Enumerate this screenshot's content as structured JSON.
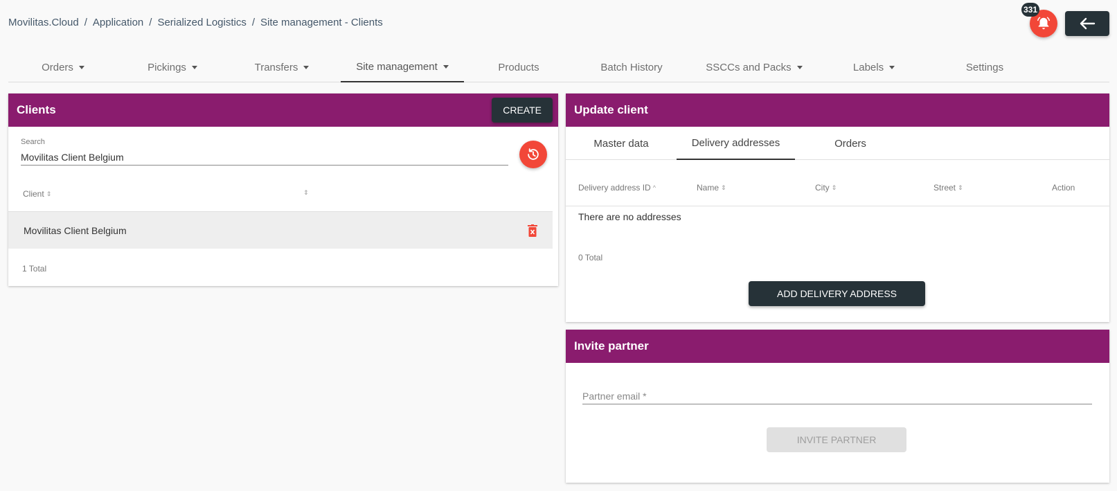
{
  "breadcrumb": {
    "items": [
      "Movilitas.Cloud",
      "Application",
      "Serialized Logistics",
      "Site management - Clients"
    ],
    "separator": "/"
  },
  "header": {
    "notification_count": "331",
    "notification_icon": "alarm-bell-icon",
    "back_icon": "arrow-left-icon"
  },
  "nav": {
    "tabs": [
      {
        "label": "Orders",
        "dropdown": true
      },
      {
        "label": "Pickings",
        "dropdown": true
      },
      {
        "label": "Transfers",
        "dropdown": true
      },
      {
        "label": "Site management",
        "dropdown": true,
        "active": true
      },
      {
        "label": "Products",
        "dropdown": false
      },
      {
        "label": "Batch History",
        "dropdown": false
      },
      {
        "label": "SSCCs and Packs",
        "dropdown": true
      },
      {
        "label": "Labels",
        "dropdown": true
      },
      {
        "label": "Settings",
        "dropdown": false
      }
    ]
  },
  "clients": {
    "title": "Clients",
    "create_label": "CREATE",
    "search_label": "Search",
    "search_value": "Movilitas Client Belgium",
    "columns": [
      "Client",
      ""
    ],
    "rows": [
      {
        "name": "Movilitas Client Belgium"
      }
    ],
    "total": "1 Total"
  },
  "update_client": {
    "title": "Update client",
    "tabs": [
      "Master data",
      "Delivery addresses",
      "Orders"
    ],
    "active_tab": "Delivery addresses",
    "columns": [
      "Delivery address ID",
      "Name",
      "City",
      "Street",
      "Action"
    ],
    "empty_message": "There are no addresses",
    "total": "0 Total",
    "add_label": "ADD DELIVERY ADDRESS"
  },
  "invite_partner": {
    "title": "Invite partner",
    "email_placeholder": "Partner email *",
    "invite_label": "INVITE PARTNER"
  },
  "colors": {
    "header_purple": "#8a1c6e",
    "dark_button": "#263238",
    "accent_red": "#f24738"
  }
}
